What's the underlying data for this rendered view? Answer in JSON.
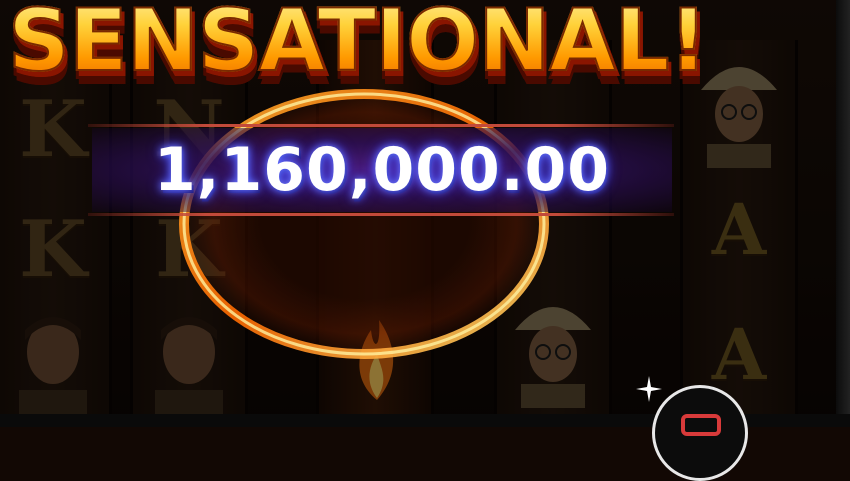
{
  "win": {
    "title": "SENSATIONAL!",
    "amount": "1,160,000.00"
  },
  "reels": {
    "col1": [
      "K",
      "K"
    ],
    "col2": [
      "N",
      "K"
    ],
    "col5": [
      "A",
      "A"
    ]
  },
  "icons": {
    "spin": "stop-square-icon",
    "sparkle": "sparkle-icon"
  },
  "colors": {
    "title_gold": "#ffd23a",
    "amount_glow": "#6f7bff",
    "banner_purple": "#50208c",
    "ring_orange": "#ff8a1a",
    "stop_red": "#d83a3a"
  }
}
